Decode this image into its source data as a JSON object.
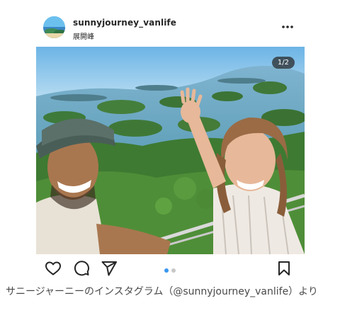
{
  "post": {
    "username": "sunnyjourney_vanlife",
    "location": "展開峰",
    "page_counter": "1/2",
    "carousel": {
      "total": 2,
      "active": 1
    }
  },
  "icons": {
    "more": "more-options-icon",
    "like": "heart-icon",
    "comment": "comment-icon",
    "share": "share-icon",
    "save": "bookmark-icon"
  },
  "caption": "サニージャーニーのインスタグラム（@sunnyjourney_vanlife）より",
  "colors": {
    "accent": "#3897f0",
    "text": "#262626",
    "caption": "#4a4a4a"
  }
}
